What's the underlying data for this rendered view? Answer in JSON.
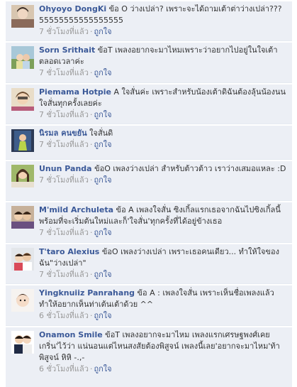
{
  "comments": [
    {
      "author": "Ohyoyo DongKi",
      "text": " ข้อ O ว่างเปล่า? เพราะจะได้ถามเต้าต่าว่างเปล่า??? 55555555555555555",
      "time": "7 ชั่วโมงที่แล้ว",
      "like": "ถูกใจ"
    },
    {
      "author": "Sorn Srithait",
      "text": " ข้อT เพลงอยากจะมาไหมเพราะว่าอยากไปอยู่ในใจเต้าตลอดเวลาค่ะ",
      "time": "7 ชั่วโมงที่แล้ว",
      "like": "ถูกใจ"
    },
    {
      "author": "Piemama Hotpie",
      "text": " A ใจสั่นค่ะ เพราะสำหรับน้องเต้าดิฉันต้องลุ้นน้องนนใจสั่นทุกครั้งเลยค่ะ",
      "time": "7 ชั่วโมงที่แล้ว",
      "like": "ถูกใจ"
    },
    {
      "author": "นิรมล คนขยัน",
      "text": " ใจสั่นดิ",
      "time": "7 ชั่วโมงที่แล้ว",
      "like": "ถูกใจ"
    },
    {
      "author": "Unun Panda",
      "text": " ข้อO เพลงว่างเปล่า สำหรับต้าวต้าว เราว่างเสมอแหละ :D",
      "time": "7 ชั่วโมงที่แล้ว",
      "like": "ถูกใจ"
    },
    {
      "author": "M'mild Archuleta",
      "text": " ข้อ A เพลงใจสั่น ซิงเกิ้ลแรกเธอจากฉันไปซิงเกิ้ลนี้พร้อมที่จะเริ่มต้นใหม่และก็'ใจสั่น'ทุกครั้งที่ได้อยู่ข้างเธอ",
      "time": "7 ชั่วโมงที่แล้ว",
      "like": "ถูกใจ"
    },
    {
      "author": "T'taro Alexius",
      "text": " ข้อO เพลงว่างเปล่า เพราะเธอคนเดียว... ทำให้ใจของฉัน\"ว่างเปล่า\"",
      "time": "7 ชั่วโมงที่แล้ว",
      "like": "ถูกใจ"
    },
    {
      "author": "Yingknuiiz Panrahang",
      "text": " ข้อ A : เพลงใจสั่น เพราะเห็นชื่อเพลงแล้วทำให้อยากเห็นท่าเต้นเต้าด้วย ^^",
      "time": "6 ชั่วโมงที่แล้ว",
      "like": "ถูกใจ"
    },
    {
      "author": "Onamon Smile",
      "text": " ข้อT เพลงอยากจะมาไหม เพลงแรกเศรษฐพงศ์เคยเกริ่น'ไว้ว่า แน่นอนแต่ไหนสงสัยต้องพิสูจน์ เพลงนี้เลย'อยากจะมาไหม'ท้าพิสูจน์ หิหิ -.,-",
      "time": "6 ชั่วโมงที่แล้ว",
      "like": "ถูกใจ"
    }
  ],
  "separator": "·",
  "colors": {
    "background": "#eceff5",
    "author": "#3b5998",
    "meta": "#999999"
  }
}
